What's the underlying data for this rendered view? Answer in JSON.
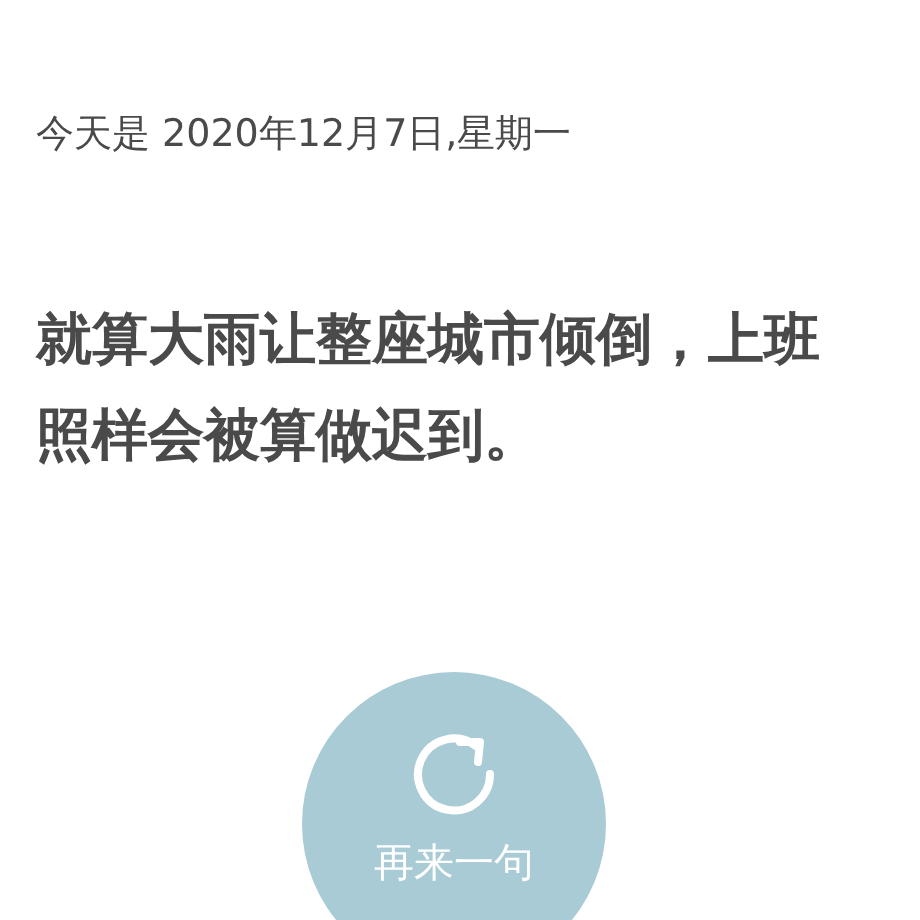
{
  "date_line": "今天是 2020年12月7日,星期一",
  "quote": "就算大雨让整座城市倾倒，上班照样会被算做迟到。",
  "refresh_button": {
    "label": "再来一句"
  }
}
